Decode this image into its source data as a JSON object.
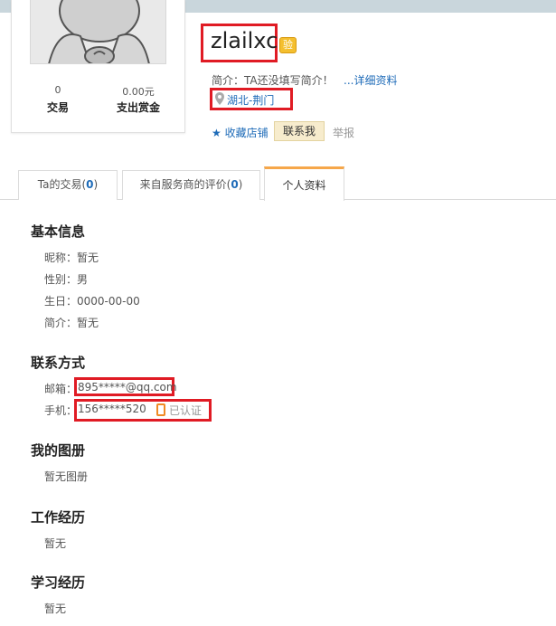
{
  "profile": {
    "stats": [
      {
        "value": "0",
        "label": "交易"
      },
      {
        "value": "0.00元",
        "label": "支出赏金"
      }
    ],
    "username": "zlailxc",
    "verify_badge": "验",
    "intro": "简介：TA还没填写简介！",
    "detail_link": "...详细资料",
    "location": "湖北-荆门",
    "favorite_shop": "收藏店铺",
    "contact_button": "联系我",
    "report": "举报"
  },
  "tabs": [
    {
      "label": "Ta的交易(",
      "count": "0",
      "suffix": ")"
    },
    {
      "label": "来自服务商的评价(",
      "count": "0",
      "suffix": ")"
    },
    {
      "label": "个人资料",
      "active": true
    }
  ],
  "basic_info": {
    "title": "基本信息",
    "nickname": "昵称：暂无",
    "gender": "性别：男",
    "birthday": "生日：0000-00-00",
    "intro": "简介：暂无"
  },
  "contact": {
    "title": "联系方式",
    "email_label": "邮箱：",
    "email_value": "895*****@qq.com",
    "phone_label": "手机：",
    "phone_value": "156*****520",
    "certified": "已认证"
  },
  "album": {
    "title": "我的图册",
    "value": "暂无图册"
  },
  "work": {
    "title": "工作经历",
    "value": "暂无"
  },
  "education": {
    "title": "学习经历",
    "value": "暂无"
  },
  "colors": {
    "accent_link": "#1e6bb8",
    "highlight_box": "#e01b24",
    "active_tab": "#f6a74a"
  }
}
